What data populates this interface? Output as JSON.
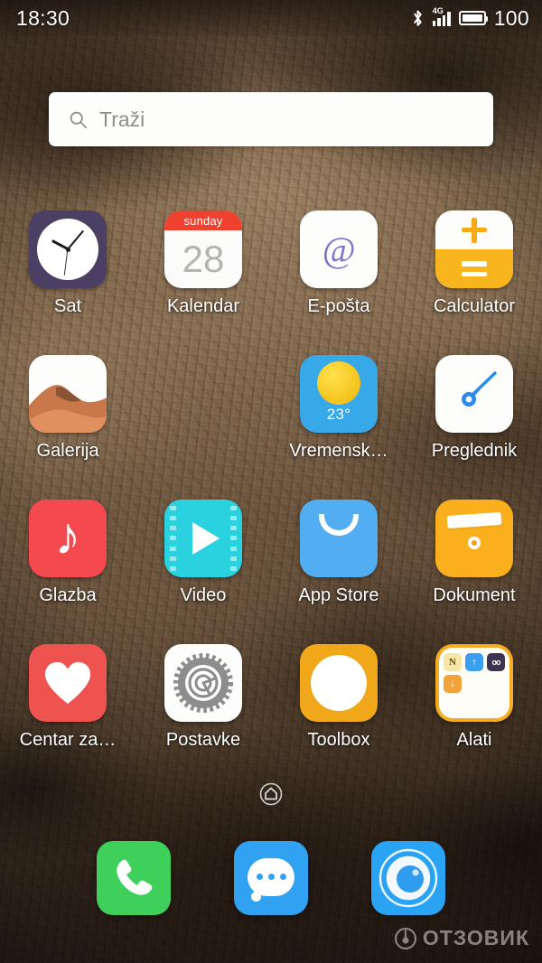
{
  "status_bar": {
    "time": "18:30",
    "bluetooth_icon": "bluetooth-icon",
    "network_type": "4G",
    "signal_icon": "signal-bars-icon",
    "battery_icon": "battery-full-icon",
    "battery_percent": "100"
  },
  "search": {
    "icon": "search-icon",
    "placeholder": "Traži",
    "value": ""
  },
  "grid": {
    "rows": [
      [
        {
          "label": "Sat",
          "icon": "clock-icon",
          "kind": "clock"
        },
        {
          "label": "Kalendar",
          "icon": "calendar-icon",
          "kind": "calendar",
          "weekday": "sunday",
          "day": "28"
        },
        {
          "label": "E-pošta",
          "icon": "mail-icon",
          "kind": "mail",
          "glyph": "@"
        },
        {
          "label": "Calculator",
          "icon": "calculator-icon",
          "kind": "calculator"
        }
      ],
      [
        {
          "label": "Galerija",
          "icon": "gallery-icon",
          "kind": "gallery"
        },
        {
          "label": "",
          "icon": "",
          "kind": "empty"
        },
        {
          "label": "Vremensk…",
          "icon": "weather-icon",
          "kind": "weather",
          "temperature": "23°"
        },
        {
          "label": "Preglednik",
          "icon": "browser-icon",
          "kind": "compass"
        }
      ],
      [
        {
          "label": "Glazba",
          "icon": "music-icon",
          "kind": "music",
          "glyph": "♪"
        },
        {
          "label": "Video",
          "icon": "video-icon",
          "kind": "video"
        },
        {
          "label": "App Store",
          "icon": "app-store-icon",
          "kind": "store"
        },
        {
          "label": "Dokument",
          "icon": "document-icon",
          "kind": "document"
        }
      ],
      [
        {
          "label": "Centar za…",
          "icon": "health-icon",
          "kind": "health"
        },
        {
          "label": "Postavke",
          "icon": "settings-gear-icon",
          "kind": "settings"
        },
        {
          "label": "Toolbox",
          "icon": "toolbox-key-icon",
          "kind": "toolbox"
        },
        {
          "label": "Alati",
          "icon": "folder-icon",
          "kind": "folder",
          "mini_icons": [
            "N",
            "↑",
            "oo",
            "↓"
          ]
        }
      ]
    ]
  },
  "page_indicator": {
    "icon": "home-page-indicator-icon",
    "pages": "1"
  },
  "dock": {
    "items": [
      {
        "label": "Phone",
        "icon": "phone-icon"
      },
      {
        "label": "Messages",
        "icon": "messages-icon"
      },
      {
        "label": "Browser",
        "icon": "eye-browser-icon"
      }
    ]
  },
  "watermark": {
    "text": "ОТЗОВИК",
    "icon": "otzovik-logo-icon"
  },
  "colors": {
    "accent_orange": "#f9b01c",
    "accent_blue": "#31a2f2",
    "accent_red": "#ef4130",
    "accent_green": "#3ed05a",
    "accent_cyan": "#2ad2e0",
    "clock_purple": "#4b3f63"
  }
}
